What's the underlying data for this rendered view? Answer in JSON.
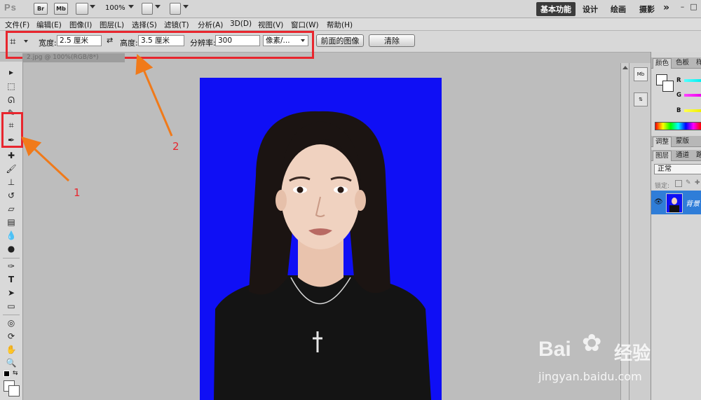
{
  "appbar": {
    "logo": "Ps",
    "icons": [
      "Br",
      "Mb"
    ],
    "zoom": "100%",
    "workspaces": [
      "基本功能",
      "设计",
      "绘画",
      "摄影"
    ],
    "more": "»"
  },
  "menu": [
    "文件(F)",
    "编辑(E)",
    "图像(I)",
    "图层(L)",
    "选择(S)",
    "滤镜(T)",
    "分析(A)",
    "3D(D)",
    "视图(V)",
    "窗口(W)",
    "帮助(H)"
  ],
  "options": {
    "width_label": "宽度:",
    "width_value": "2.5 厘米",
    "height_label": "高度:",
    "height_value": "3.5 厘米",
    "resolution_label": "分辨率:",
    "resolution_value": "300",
    "unit": "像素/...",
    "front_image": "前面的图像",
    "clear": "清除"
  },
  "document_tab": "2.jpg @ 100%(RGB/8*)",
  "annotations": {
    "label1": "1",
    "label2": "2",
    "color": "#e8262e",
    "arrow_color": "#f07a1a"
  },
  "panels": {
    "color_tabs": [
      "颜色",
      "色板",
      "样"
    ],
    "rgb": [
      "R",
      "G",
      "B"
    ],
    "adjust_tabs": [
      "调整",
      "蒙版"
    ],
    "layer_tabs": [
      "图层",
      "通道",
      "路"
    ],
    "blend_mode": "正常",
    "lock_label": "锁定:",
    "layer_name": "背景"
  },
  "watermark": {
    "brand": "Bai",
    "brand2": "经验",
    "url": "jingyan.baidu.com"
  }
}
